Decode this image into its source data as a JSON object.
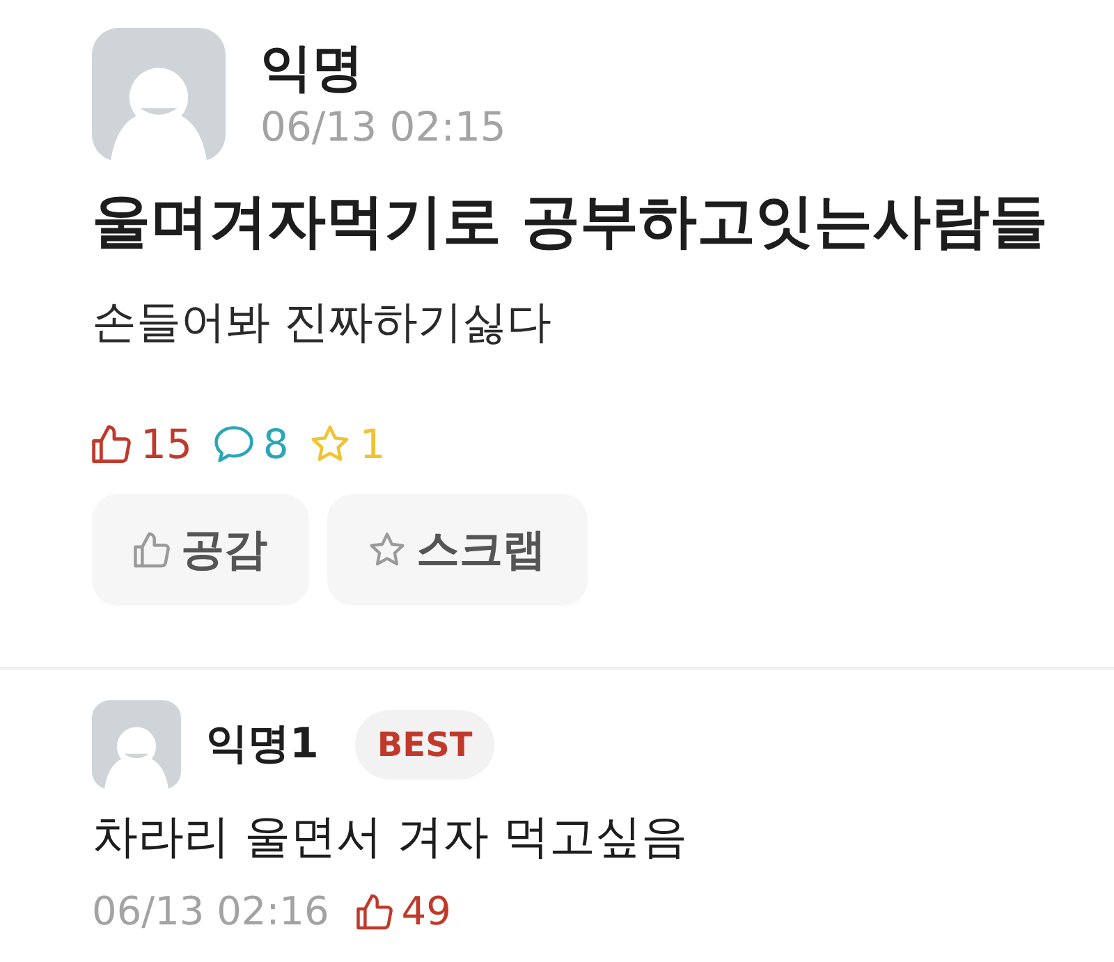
{
  "post": {
    "author": "익명",
    "time": "06/13 02:15",
    "title": "울며겨자먹기로 공부하고잇는사람들",
    "body": "손들어봐 진짜하기싫다",
    "stats": [
      {
        "kind": "like",
        "count": "15",
        "color": "#c0392b"
      },
      {
        "kind": "comment",
        "count": "8",
        "color": "#2aa6b8"
      },
      {
        "kind": "scrap",
        "count": "1",
        "color": "#f1c232"
      }
    ],
    "buttons": [
      {
        "kind": "like",
        "label": "공감"
      },
      {
        "kind": "scrap",
        "label": "스크랩"
      }
    ]
  },
  "comments": [
    {
      "author": "익명1",
      "badge": "BEST",
      "text": "차라리 울면서 겨자 먹고싶음",
      "time": "06/13 02:16",
      "likes": "49"
    }
  ]
}
